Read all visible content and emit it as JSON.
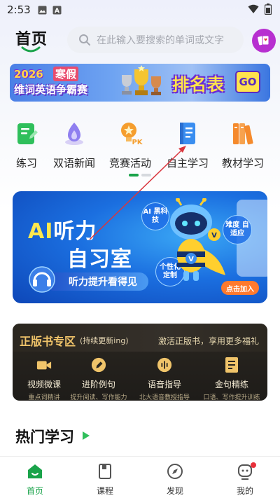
{
  "status_bar": {
    "time": "2:53",
    "icons": [
      "image-icon",
      "a-icon",
      "wifi-icon",
      "battery-icon"
    ]
  },
  "header": {
    "title": "首页",
    "search_placeholder": "在此输入要搜索的单词或文字"
  },
  "banner": {
    "year": "2026",
    "season": "寒假",
    "subtitle": "维词英语争霸赛",
    "rank_text": "排名表",
    "go_label": "GO"
  },
  "quick_menu": [
    {
      "label": "练习",
      "icon": "pencil-note-icon"
    },
    {
      "label": "双语新闻",
      "icon": "flame-icon"
    },
    {
      "label": "竞赛活动",
      "icon": "pk-trophy-icon"
    },
    {
      "label": "自主学习",
      "icon": "notebook-icon"
    },
    {
      "label": "教材学习",
      "icon": "books-icon"
    }
  ],
  "ai_card": {
    "title_ai": "AI",
    "title_1": "听力",
    "title_2": "自习室",
    "pill": "听力提升看得见",
    "bubble_1": "AI 黑科技",
    "bubble_2": "难度 自适应",
    "bubble_3": "个性化 定制",
    "join_button": "点击加入"
  },
  "official_books": {
    "title": "正版书专区",
    "tag": "(持续更新ing)",
    "activate": "激活正版书，享用更多福礼",
    "items": [
      {
        "label": "视频微课",
        "sub": "重点词精讲",
        "icon": "video-camera-icon"
      },
      {
        "label": "进阶例句",
        "sub": "提升阅读、写作能力",
        "icon": "pen-icon"
      },
      {
        "label": "语音指导",
        "sub": "北大语音教授指导",
        "icon": "voice-icon"
      },
      {
        "label": "金句精练",
        "sub": "口语、写作提升训练",
        "icon": "document-icon"
      }
    ]
  },
  "hot_section": {
    "title": "热门学习"
  },
  "bottom_nav": [
    {
      "label": "首页",
      "icon": "home-icon",
      "active": true
    },
    {
      "label": "课程",
      "icon": "book-icon",
      "active": false
    },
    {
      "label": "发现",
      "icon": "compass-icon",
      "active": false
    },
    {
      "label": "我的",
      "icon": "profile-icon",
      "active": false
    }
  ],
  "colors": {
    "accent_green": "#1aa34a",
    "annotation_red": "#d9363e",
    "avatar_purple": "#b72fd0"
  }
}
